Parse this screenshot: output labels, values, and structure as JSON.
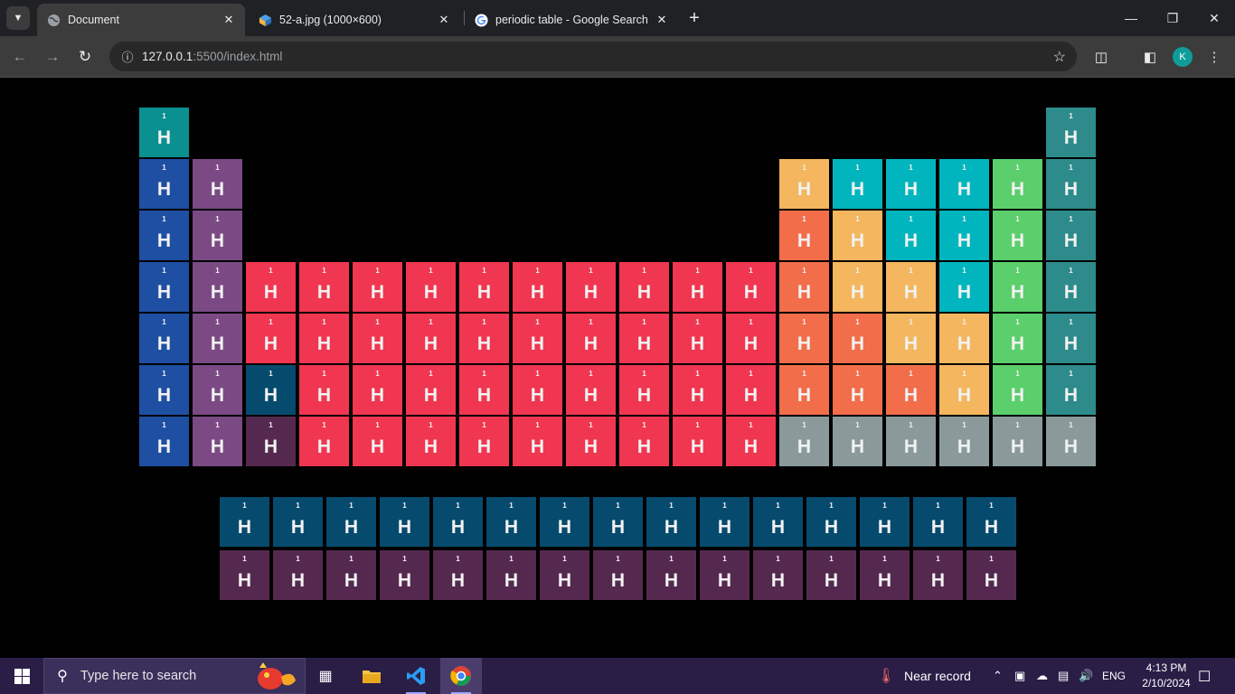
{
  "browser": {
    "tabs": [
      {
        "title": "Document",
        "favicon": "globe-icon",
        "active": true
      },
      {
        "title": "52-a.jpg (1000×600)",
        "favicon": "image-viewer-icon",
        "active": false
      },
      {
        "title": "periodic table - Google Search",
        "favicon": "google-icon",
        "active": false
      }
    ],
    "address": {
      "host": "127.0.0.1",
      "rest": ":5500/index.html"
    },
    "profile_initial": "K"
  },
  "element_cell": {
    "number": "1",
    "symbol": "H"
  },
  "colors": {
    "alkali": "#1e4fa3",
    "alkaline": "#7b4a84",
    "transition": "#f03650",
    "post_transition": "#f26d4a",
    "metalloid": "#f4b65e",
    "nonmetal": "#00b5bd",
    "halogen": "#5bcf6b",
    "noble": "#2e8b8b",
    "hydrogen": "#0a9090",
    "unknown": "#8a9a9a",
    "lanthanide": "#064a6e",
    "actinide": "#55294f"
  },
  "taskbar": {
    "search_placeholder": "Type here to search",
    "weather": "Near record",
    "language": "ENG",
    "time": "4:13 PM",
    "date": "2/10/2024"
  }
}
